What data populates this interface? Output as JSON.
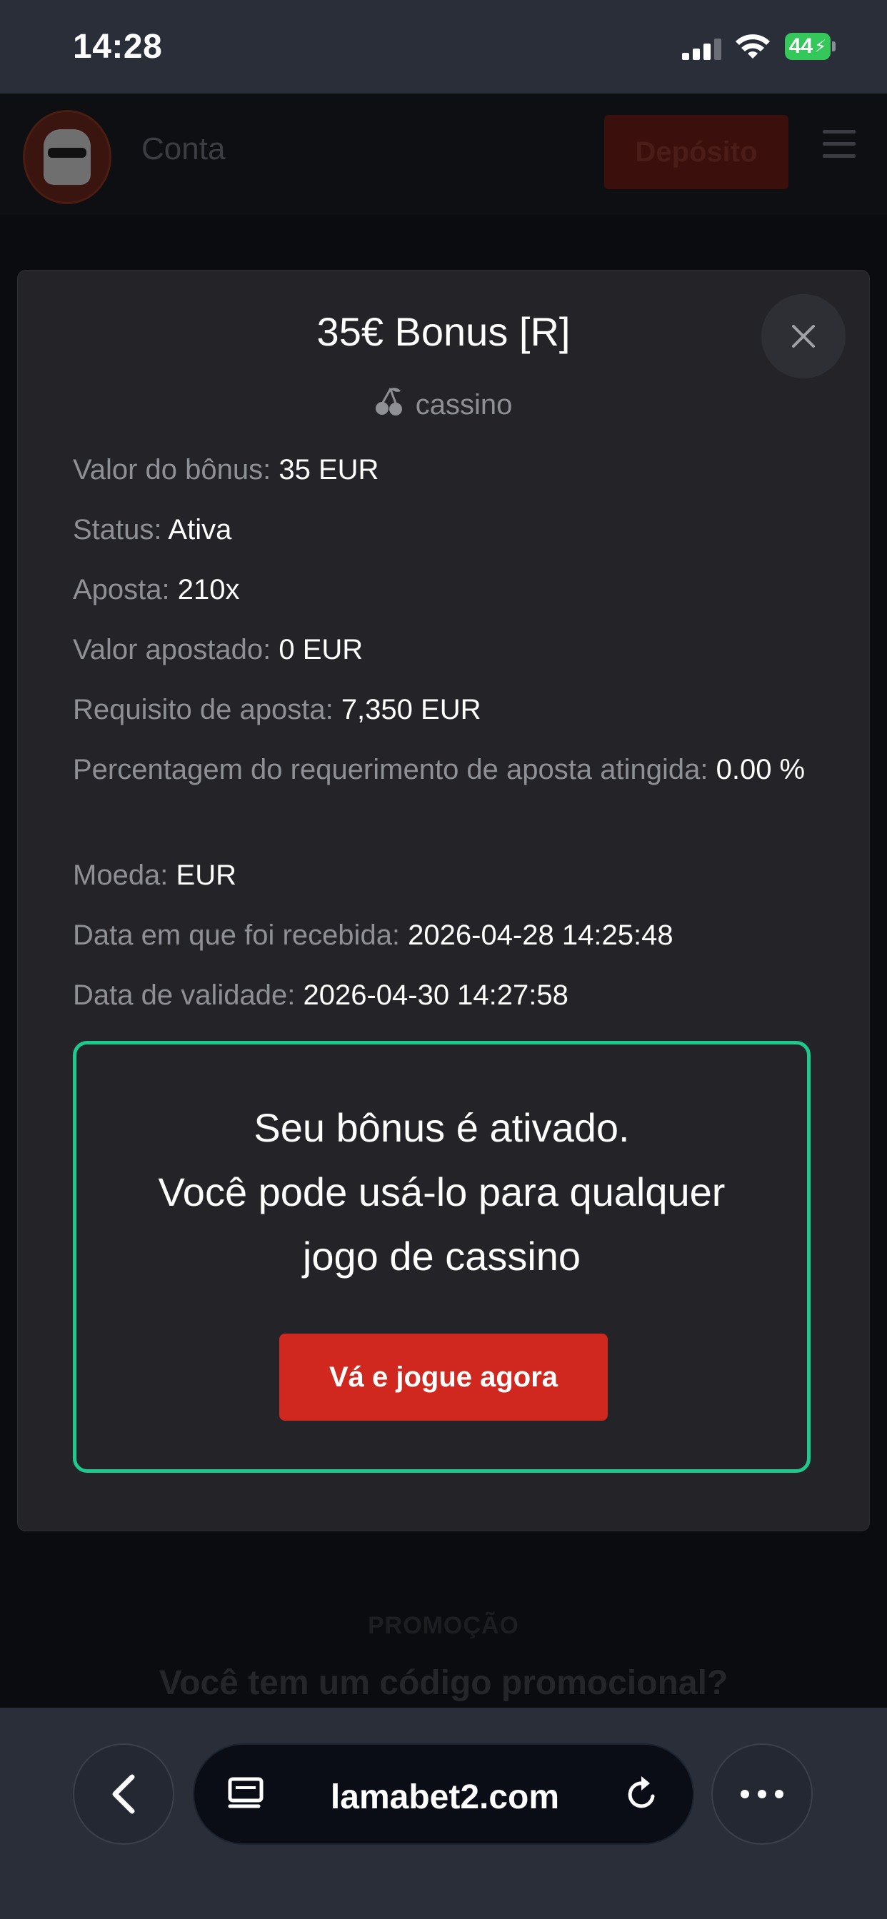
{
  "status_bar": {
    "time": "14:28",
    "battery": "44",
    "icons": [
      "cellular-signal-icon",
      "wifi-icon",
      "battery-charging-icon"
    ]
  },
  "site_header": {
    "logo_icon": "llama-logo-icon",
    "account_label": "Conta",
    "deposit_label": "Depósito",
    "menu_icon": "hamburger-menu-icon"
  },
  "modal": {
    "title": "35€ Bonus [R]",
    "category_icon": "cherry-icon",
    "category": "cassino",
    "close_icon": "close-icon",
    "details": [
      {
        "label": "Valor do bônus: ",
        "value": "35 EUR"
      },
      {
        "label": "Status: ",
        "value": "Ativa"
      },
      {
        "label": "Aposta: ",
        "value": "210x"
      },
      {
        "label": "Valor apostado: ",
        "value": "0 EUR"
      },
      {
        "label": "Requisito de aposta: ",
        "value": "7,350 EUR"
      },
      {
        "label": "Percentagem do requerimento de aposta atingida: ",
        "value": "0.00 %"
      },
      {
        "label": "Moeda: ",
        "value": "EUR"
      },
      {
        "label": "Data em que foi recebida: ",
        "value": "2026-04-28 14:25:48"
      },
      {
        "label": "Data de validade: ",
        "value": "2026-04-30 14:27:58"
      }
    ],
    "active_message": {
      "line1": "Seu bônus é ativado.",
      "line2": "Você pode usá-lo para qualquer",
      "line3": "jogo de cassino"
    },
    "play_button": "Vá e jogue agora"
  },
  "background_page": {
    "promo_label": "PROMOÇÃO",
    "promo_question": "Você tem um código promocional?"
  },
  "browser_bar": {
    "url": "lamabet2.com",
    "back_icon": "chevron-left-icon",
    "tabs_icon": "tabs-icon",
    "reload_icon": "reload-icon",
    "more_icon": "more-dots-icon"
  },
  "colors": {
    "accent_green": "#1ec98e",
    "play_red": "#d0281e",
    "modal_bg": "#242428"
  }
}
